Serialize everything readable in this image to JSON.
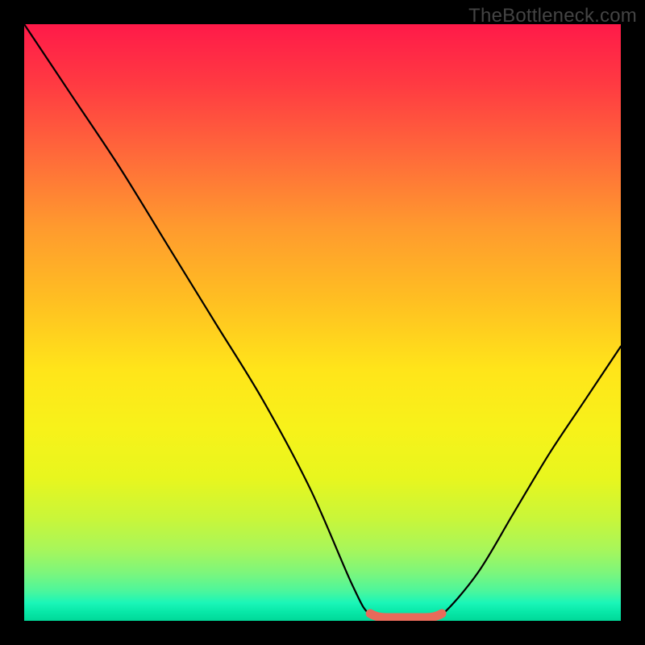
{
  "watermark": "TheBottleneck.com",
  "chart_data": {
    "type": "line",
    "title": "",
    "xlabel": "",
    "ylabel": "",
    "xlim": [
      0,
      100
    ],
    "ylim": [
      0,
      100
    ],
    "series": [
      {
        "name": "bottleneck-curve",
        "x": [
          0,
          8,
          16,
          24,
          32,
          40,
          48,
          55,
          58,
          62,
          67,
          70,
          76,
          82,
          88,
          94,
          100
        ],
        "values": [
          100,
          88,
          76,
          63,
          50,
          37,
          22,
          6,
          1,
          0,
          0,
          1,
          8,
          18,
          28,
          37,
          46
        ]
      }
    ],
    "annotations": [
      {
        "name": "bottom-segment",
        "x_start": 58,
        "x_end": 70,
        "value": 0
      }
    ],
    "gradient_stops": [
      {
        "pct": 0,
        "color": "#ff1a49"
      },
      {
        "pct": 50,
        "color": "#ffd020"
      },
      {
        "pct": 100,
        "color": "#00d898"
      }
    ]
  }
}
